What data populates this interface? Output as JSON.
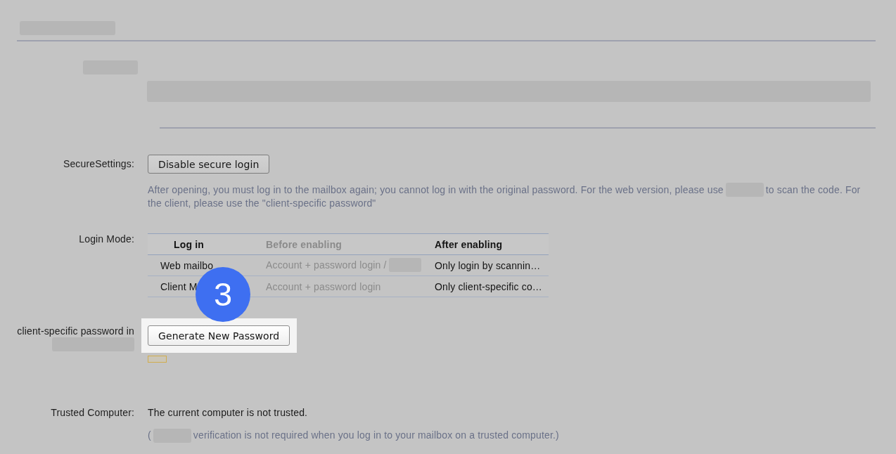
{
  "secure_settings": {
    "label": [
      {
        "kind": "text",
        "text": "SecureSettings:"
      }
    ],
    "button": {
      "label": "Disable secure login",
      "highlighted": false
    },
    "note": [
      {
        "kind": "text",
        "text": "After opening, you must log in to the mailbox again; you cannot log in with the original password. For the web version, please use"
      },
      {
        "kind": "redacted"
      },
      {
        "kind": "text",
        "text": "to scan the code. For the client, please use the \"client-specific password\""
      }
    ]
  },
  "login_mode": {
    "label": [
      {
        "kind": "text",
        "text": "Login Mode:"
      }
    ],
    "columns": [
      {
        "label": "Log in",
        "muted": false
      },
      {
        "label": "Before enabling",
        "muted": true
      },
      {
        "label": "After enabling",
        "muted": false
      }
    ],
    "rows": [
      [
        [
          {
            "kind": "text",
            "text": "Web mailbo"
          }
        ],
        [
          {
            "kind": "text",
            "text": "Account + password login /"
          },
          {
            "kind": "redacted"
          }
        ],
        [
          {
            "kind": "text",
            "text": "Only login by scannin…"
          }
        ]
      ],
      [
        [
          {
            "kind": "text",
            "text": "Client M"
          }
        ],
        [
          {
            "kind": "text",
            "text": "Account + password login"
          }
        ],
        [
          {
            "kind": "text",
            "text": "Only client-specific co…"
          }
        ]
      ]
    ]
  },
  "client_password": {
    "label": [
      {
        "kind": "text",
        "text": "client-specific password in"
      },
      {
        "kind": "redacted"
      }
    ],
    "button": {
      "label": "Generate New Password",
      "highlighted": true
    }
  },
  "trusted_computer": {
    "label": [
      {
        "kind": "text",
        "text": "Trusted Computer:"
      }
    ],
    "status": "The current computer is not trusted.",
    "note": [
      {
        "kind": "text",
        "text": "("
      },
      {
        "kind": "redacted"
      },
      {
        "kind": "text",
        "text": "verification is not required when you log in to your mailbox on a trusted computer.)"
      }
    ]
  },
  "step_badge": "3"
}
